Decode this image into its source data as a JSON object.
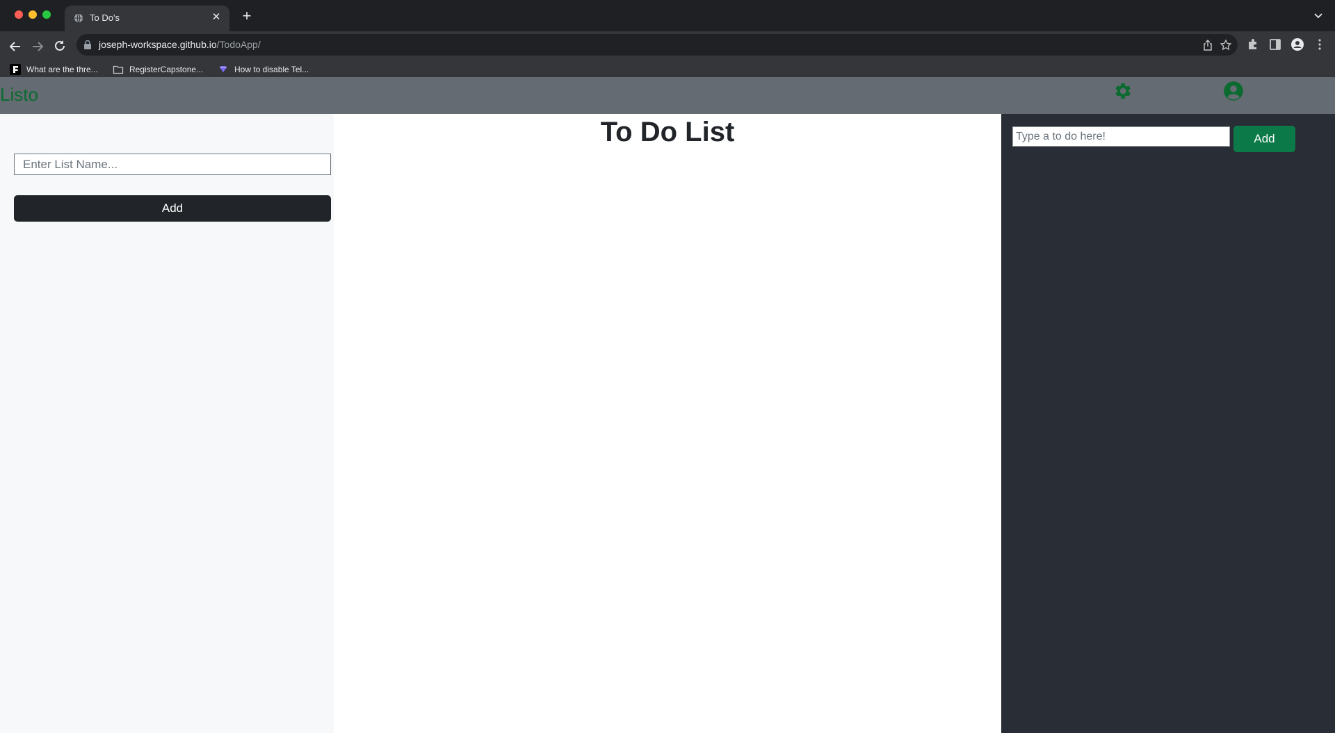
{
  "browser": {
    "tab_title": "To Do's",
    "url_host": "joseph-workspace.github.io",
    "url_path": "/TodoApp/",
    "bookmarks": [
      {
        "label": "What are the thre...",
        "icon": "f-logo-icon"
      },
      {
        "label": "RegisterCapstone...",
        "icon": "folder-icon"
      },
      {
        "label": "How to disable Tel...",
        "icon": "gem-icon"
      }
    ]
  },
  "navbar": {
    "brand": "Listo",
    "brand_color": "#0b6b2e",
    "icons": [
      "gear-icon",
      "user-circle-icon"
    ]
  },
  "left_sidebar": {
    "list_name_placeholder": "Enter List Name...",
    "list_name_value": "",
    "add_label": "Add"
  },
  "main": {
    "title": "To Do List"
  },
  "right_sidebar": {
    "todo_placeholder": "Type a to do here!",
    "todo_value": "",
    "add_label": "Add",
    "accent": "#0c7a48"
  }
}
